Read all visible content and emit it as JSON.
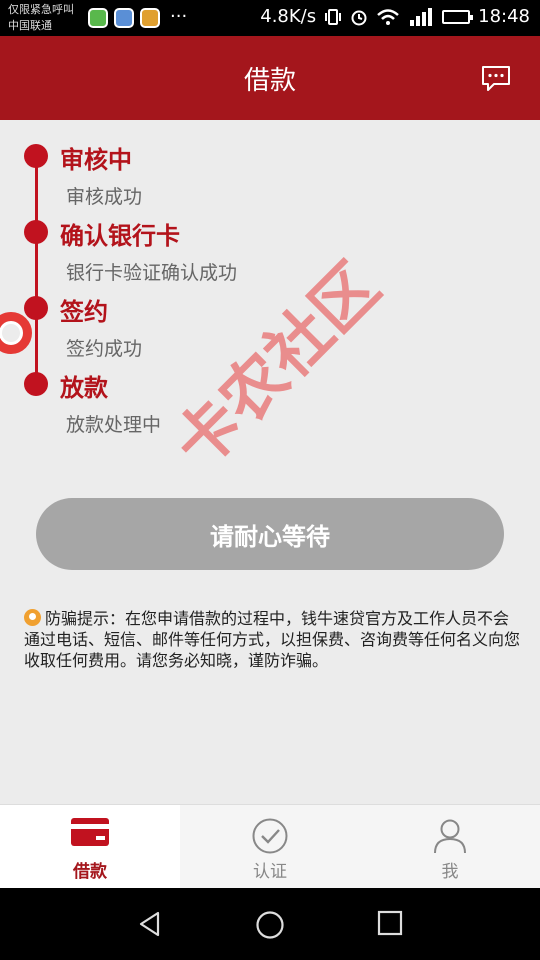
{
  "status_bar": {
    "line1": "仅限紧急呼叫",
    "line2": "中国联通",
    "speed": "4.8K/s",
    "time": "18:48",
    "icons": [
      "app-icon",
      "app-icon",
      "app-icon",
      "more-icon",
      "vibrate-icon",
      "alarm-icon",
      "wifi-icon",
      "signal-icon",
      "battery-icon"
    ]
  },
  "header": {
    "title": "借款",
    "message_icon": "chat-bubble-icon"
  },
  "steps": [
    {
      "title": "审核中",
      "subtitle": "审核成功"
    },
    {
      "title": "确认银行卡",
      "subtitle": "银行卡验证确认成功"
    },
    {
      "title": "签约",
      "subtitle": "签约成功"
    },
    {
      "title": "放款",
      "subtitle": "放款处理中"
    }
  ],
  "wait_button": {
    "label": "请耐心等待"
  },
  "notice": {
    "icon": "warning-icon",
    "text": "防骗提示：在您申请借款的过程中，钱牛速贷官方及工作人员不会通过电话、短信、邮件等任何方式，以担保费、咨询费等任何名义向您收取任何费用。请您务必知晓，谨防诈骗。"
  },
  "watermark": {
    "text": "卡农社区"
  },
  "tabbar": {
    "tabs": [
      {
        "label": "借款",
        "icon": "card-icon",
        "active": true
      },
      {
        "label": "认证",
        "icon": "check-circle-icon",
        "active": false
      },
      {
        "label": "我",
        "icon": "user-icon",
        "active": false
      }
    ]
  },
  "colors": {
    "primary": "#a4161c",
    "accent": "#c1121f",
    "button_disabled": "#a6a6a6",
    "background": "#ececec"
  }
}
